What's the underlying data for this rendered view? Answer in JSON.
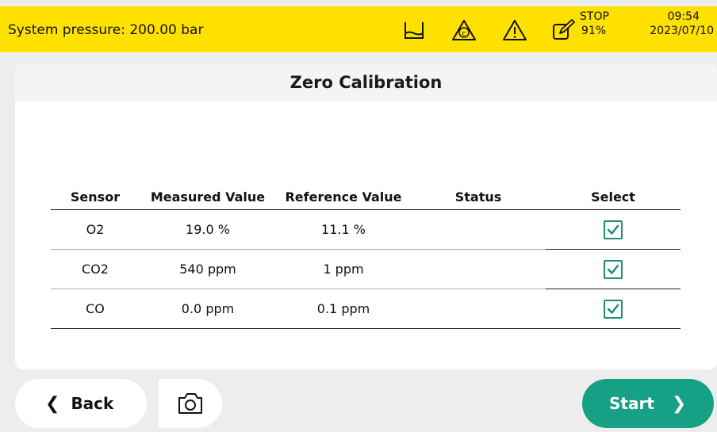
{
  "statusbar": {
    "pressure": "System pressure: 200.00 bar",
    "icons": [
      "container-icon",
      "calibration-c-icon",
      "warning-icon",
      "edit-icon"
    ],
    "stop_label": "STOP",
    "stop_percent": "91%",
    "time": "09:54",
    "date": "2023/07/10",
    "bg_color": "#ffe100"
  },
  "page": {
    "title": "Zero Calibration"
  },
  "table": {
    "headers": {
      "sensor": "Sensor",
      "measured": "Measured Value",
      "reference": "Reference Value",
      "status": "Status",
      "select": "Select"
    },
    "rows": [
      {
        "sensor": "O2",
        "measured": "19.0 %",
        "reference": "11.1 %",
        "status": "",
        "selected": true
      },
      {
        "sensor": "CO2",
        "measured": "540 ppm",
        "reference": "1 ppm",
        "status": "",
        "selected": true
      },
      {
        "sensor": "CO",
        "measured": "0.0 ppm",
        "reference": "0.1 ppm",
        "status": "",
        "selected": true
      }
    ]
  },
  "footer": {
    "back_label": "Back",
    "start_label": "Start",
    "camera_icon": "camera-icon",
    "accent_color": "#16a085"
  }
}
